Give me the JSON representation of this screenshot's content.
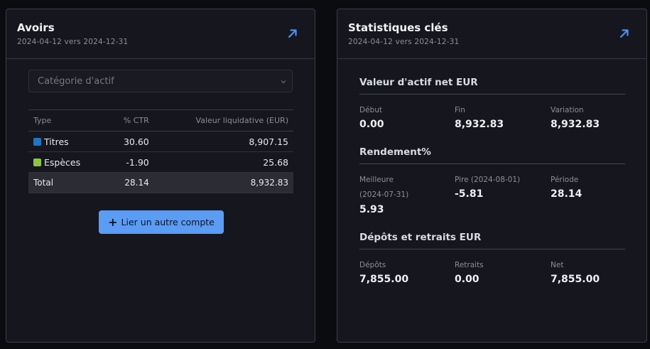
{
  "holdings_card": {
    "title": "Avoirs",
    "date_range": "2024-04-12 vers 2024-12-31",
    "category_select": {
      "placeholder": "Catégorie d'actif"
    },
    "table": {
      "headers": {
        "type": "Type",
        "ctr": "% CTR",
        "value": "Valeur liquidative (EUR)"
      },
      "rows": [
        {
          "type": "Titres",
          "color": "#1d77c5",
          "ctr": "30.60",
          "value": "8,907.15",
          "value_color": "green"
        },
        {
          "type": "Espèces",
          "color": "#8cc63f",
          "ctr": "-1.90",
          "value": "25.68",
          "value_color": "red"
        }
      ],
      "total": {
        "label": "Total",
        "ctr": "28.14",
        "value": "8,932.83"
      }
    },
    "link_button": "Lier un autre compte"
  },
  "stats_card": {
    "title": "Statistiques clés",
    "date_range": "2024-04-12 vers 2024-12-31",
    "nav": {
      "title": "Valeur d'actif net EUR",
      "start_label": "Début",
      "start_value": "0.00",
      "end_label": "Fin",
      "end_value": "8,932.83",
      "change_label": "Variation",
      "change_value": "8,932.83"
    },
    "returns": {
      "title": "Rendement%",
      "best_label": "Meilleure",
      "best_date": "(2024-07-31)",
      "best_value": "5.93",
      "worst_label": "Pire (2024-08-01)",
      "worst_value": "-5.81",
      "period_label": "Période",
      "period_value": "28.14"
    },
    "flows": {
      "title": "Dépôts et retraits EUR",
      "deposits_label": "Dépôts",
      "deposits_value": "7,855.00",
      "withdrawals_label": "Retraits",
      "withdrawals_value": "0.00",
      "net_label": "Net",
      "net_value": "7,855.00"
    }
  },
  "colors": {
    "accent": "#5b9cf5",
    "positive": "#2db34f",
    "negative": "#f0414b"
  },
  "icons": {
    "expand": "arrow-up-right-icon",
    "dropdown": "chevron-down-icon",
    "add": "plus-icon"
  }
}
